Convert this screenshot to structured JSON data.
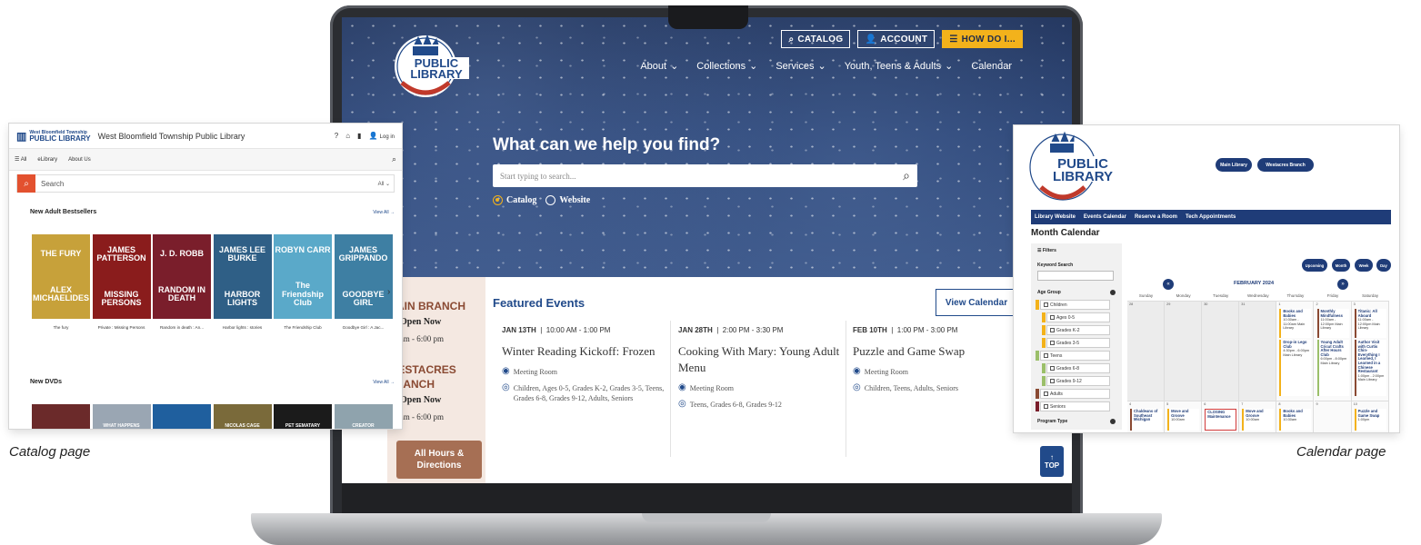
{
  "laptop": {
    "top_buttons": [
      {
        "label": "CATALOG",
        "icon": "search-icon"
      },
      {
        "label": "ACCOUNT",
        "icon": "user-icon"
      },
      {
        "label": "HOW DO I...",
        "icon": "menu-icon"
      }
    ],
    "nav": [
      {
        "label": "About",
        "dropdown": true
      },
      {
        "label": "Collections",
        "dropdown": true
      },
      {
        "label": "Services",
        "dropdown": true
      },
      {
        "label": "Youth, Teens & Adults",
        "dropdown": true
      },
      {
        "label": "Calendar",
        "dropdown": false
      }
    ],
    "logo_lines": [
      "PUBLIC",
      "LIBRARY"
    ],
    "logo_ring": "WEST BLOOMFIELD TOWNSHIP",
    "hero_title": "What can we help you find?",
    "search_placeholder": "Start typing to search...",
    "radios": [
      {
        "label": "Catalog",
        "checked": true
      },
      {
        "label": "Website",
        "checked": false
      }
    ],
    "branches": [
      {
        "name_line1": "MAIN BRANCH",
        "name_line2": "",
        "status": "Open Now",
        "hours": ":00 am - 6:00 pm"
      },
      {
        "name_line1": "WESTACRES",
        "name_line2": "BRANCH",
        "status": "Open Now",
        "hours": ":00 am - 6:00 pm"
      }
    ],
    "hours_button_line1": "All Hours &",
    "hours_button_line2": "Directions",
    "featured_title": "Featured Events",
    "view_calendar": "View Calendar",
    "events": [
      {
        "date": "JAN 13TH",
        "time": "10:00 AM - 1:00 PM",
        "title": "Winter Reading Kickoff: Frozen",
        "location": "Meeting Room",
        "audience": "Children, Ages 0-5, Grades K-2, Grades 3-5, Teens, Grades 6-8, Grades 9-12, Adults, Seniors"
      },
      {
        "date": "JAN 28TH",
        "time": "2:00 PM - 3:30 PM",
        "title": "Cooking With Mary: Young Adult Menu",
        "location": "Meeting Room",
        "audience": "Teens, Grades 6-8, Grades 9-12"
      },
      {
        "date": "FEB 10TH",
        "time": "1:00 PM - 3:00 PM",
        "title": "Puzzle and Game Swap",
        "location": "Meeting Room",
        "audience": "Children, Teens, Adults, Seniors"
      }
    ],
    "top_label": "TOP",
    "colors": {
      "navy": "#214a8a",
      "gold": "#f3b21b",
      "brown": "#a66f54"
    }
  },
  "catalog": {
    "logo_small": "West Bloomfield Township",
    "logo_big": "PUBLIC LIBRARY",
    "title": "West Bloomfield Township Public Library",
    "login": "Log in",
    "subnav": [
      "All",
      "eLibrary",
      "About Us"
    ],
    "search_placeholder": "Search",
    "search_scope": "All",
    "section1": "New Adult Bestsellers",
    "view_all": "View All →",
    "books": [
      {
        "cover_top": "THE FURY",
        "cover_bottom": "ALEX MICHAELIDES",
        "caption": "The fury",
        "bg": "#c7a13a"
      },
      {
        "cover_top": "JAMES PATTERSON",
        "cover_bottom": "MISSING PERSONS",
        "caption": "Private : Missing Persons",
        "bg": "#8a1c1c"
      },
      {
        "cover_top": "J. D. ROBB",
        "cover_bottom": "RANDOM IN DEATH",
        "caption": "Random in death : An...",
        "bg": "#7a1e2b"
      },
      {
        "cover_top": "JAMES LEE BURKE",
        "cover_bottom": "HARBOR LIGHTS",
        "caption": "Harbor lights : stories",
        "bg": "#2f5f86"
      },
      {
        "cover_top": "ROBYN CARR",
        "cover_bottom": "The Friendship Club",
        "caption": "The Friendship Club",
        "bg": "#5aa9c9"
      },
      {
        "cover_top": "JAMES GRIPPANDO",
        "cover_bottom": "GOODBYE GIRL",
        "caption": "Goodbye Girl : A Jac...",
        "bg": "#3e7fa3"
      }
    ],
    "section2": "New DVDs",
    "dvds": [
      {
        "label": "",
        "bg": "#6b2a2a"
      },
      {
        "label": "WHAT HAPPENS",
        "bg": "#9aa6b3"
      },
      {
        "label": "",
        "bg": "#1f5f9e"
      },
      {
        "label": "NICOLAS CAGE",
        "bg": "#7a6a3a"
      },
      {
        "label": "PET SEMATARY",
        "bg": "#1b1b1b"
      },
      {
        "label": "CREATOR",
        "bg": "#8fa3ad"
      }
    ]
  },
  "calendar": {
    "branch_buttons": [
      "Main Library",
      "Westacres Branch"
    ],
    "nav": [
      "Library Website",
      "Events Calendar",
      "Reserve a Room",
      "Tech Appointments"
    ],
    "heading": "Month Calendar",
    "filters_label": "Filters",
    "keyword_label": "Keyword Search",
    "age_group_label": "Age Group",
    "age_groups": [
      {
        "label": "Children",
        "color": "#f3b21b",
        "indent": false
      },
      {
        "label": "Ages 0-5",
        "color": "#f3b21b",
        "indent": true
      },
      {
        "label": "Grades K-2",
        "color": "#f3b21b",
        "indent": true
      },
      {
        "label": "Grades 3-5",
        "color": "#f3b21b",
        "indent": true
      },
      {
        "label": "Teens",
        "color": "#9bbf6a",
        "indent": false
      },
      {
        "label": "Grades 6-8",
        "color": "#9bbf6a",
        "indent": true
      },
      {
        "label": "Grades 9-12",
        "color": "#9bbf6a",
        "indent": true
      },
      {
        "label": "Adults",
        "color": "#8a4a33",
        "indent": false
      },
      {
        "label": "Seniors",
        "color": "#7a1e2b",
        "indent": false
      }
    ],
    "program_type_label": "Program Type",
    "views": [
      "Upcoming",
      "Month",
      "Week",
      "Day"
    ],
    "month": "FEBRUARY 2024",
    "prev": "«",
    "next": "»",
    "weekdays": [
      "Sunday",
      "Monday",
      "Tuesday",
      "Wednesday",
      "Thursday",
      "Friday",
      "Saturday"
    ],
    "week1_days": [
      "28",
      "29",
      "30",
      "31",
      "1",
      "2",
      "3"
    ],
    "week2_days": [
      "4",
      "5",
      "6",
      "7",
      "8",
      "9",
      "10"
    ],
    "events_week1": [
      {
        "title": "Books and Babies",
        "detail": "10:30am - 11:00am Main Library",
        "day": 4,
        "slot": 0,
        "color": "#f3b21b"
      },
      {
        "title": "Drop-in Lego Club",
        "detail": "4:30pm - 6:00pm Main Library",
        "day": 4,
        "slot": 1,
        "color": "#f3b21b"
      },
      {
        "title": "Monthly Mindfulness",
        "detail": "11:00am - 12:00pm Main Library",
        "day": 5,
        "slot": 0,
        "color": "#8a4a33"
      },
      {
        "title": "Young Adult Cricut Crafts After Hours Club",
        "detail": "6:00pm - 8:00pm Main Library",
        "day": 5,
        "slot": 1,
        "color": "#9bbf6a"
      },
      {
        "title": "Titanic: All Aboard",
        "detail": "11:00am - 12:00pm Main Library",
        "day": 6,
        "slot": 0,
        "color": "#8a4a33"
      },
      {
        "title": "Author Visit with Curtis Chin- Everything I Learned, I Learned in a Chinese Restaurant",
        "detail": "1:00pm - 2:00pm Main Library",
        "day": 6,
        "slot": 1,
        "color": "#8a4a33"
      }
    ],
    "events_week2": [
      {
        "title": "Chaldeans of Southeast Michigan",
        "day": 0,
        "color": "#8a4a33"
      },
      {
        "title": "Move and Groove",
        "detail": "10:00am",
        "day": 1,
        "color": "#f3b21b"
      },
      {
        "title": "CLOSING Maintenance",
        "day": 2,
        "color": "#d23b3b"
      },
      {
        "title": "Move and Groove",
        "detail": "10:00am",
        "day": 3,
        "color": "#f3b21b"
      },
      {
        "title": "Books and Babies",
        "detail": "10:30am",
        "day": 4,
        "color": "#f3b21b"
      },
      {
        "title": "Puzzle and Game Swap",
        "detail": "1:00pm",
        "day": 6,
        "color": "#f3b21b"
      }
    ]
  },
  "captions": {
    "left": "Catalog page",
    "right": "Calendar page"
  }
}
